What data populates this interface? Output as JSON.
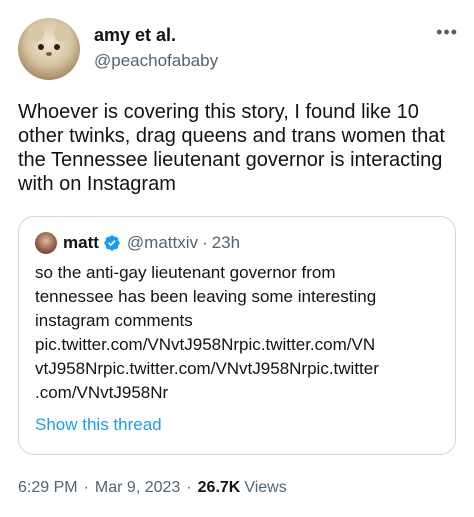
{
  "author": {
    "display_name": "amy et al.",
    "handle": "@peachofababy",
    "more_icon": "•••"
  },
  "tweet": {
    "text": "Whoever is covering this story, I found like 10 other twinks, drag queens and trans women that the Tennessee lieutenant governor is interacting with on Instagram"
  },
  "quoted": {
    "display_name": "matt",
    "handle": "@mattxiv",
    "separator": "·",
    "time": "23h",
    "text": "so the anti-gay lieutenant governor from\ntennessee has been leaving some interesting\ninstagram comments\npic.twitter.com/VNvtJ958Nrpic.twitter.com/VN\nvtJ958Nrpic.twitter.com/VNvtJ958Nrpic.twitter\n.com/VNvtJ958Nr",
    "show_thread": "Show this thread",
    "verified_color": "#1d9bf0"
  },
  "meta": {
    "time": "6:29 PM",
    "separator": "·",
    "date": "Mar 9, 2023",
    "views_count": "26.7K",
    "views_label": "Views"
  },
  "colors": {
    "text": "#0f1419",
    "secondary": "#536471",
    "link": "#1d9bf0",
    "border": "#cfd9de"
  }
}
